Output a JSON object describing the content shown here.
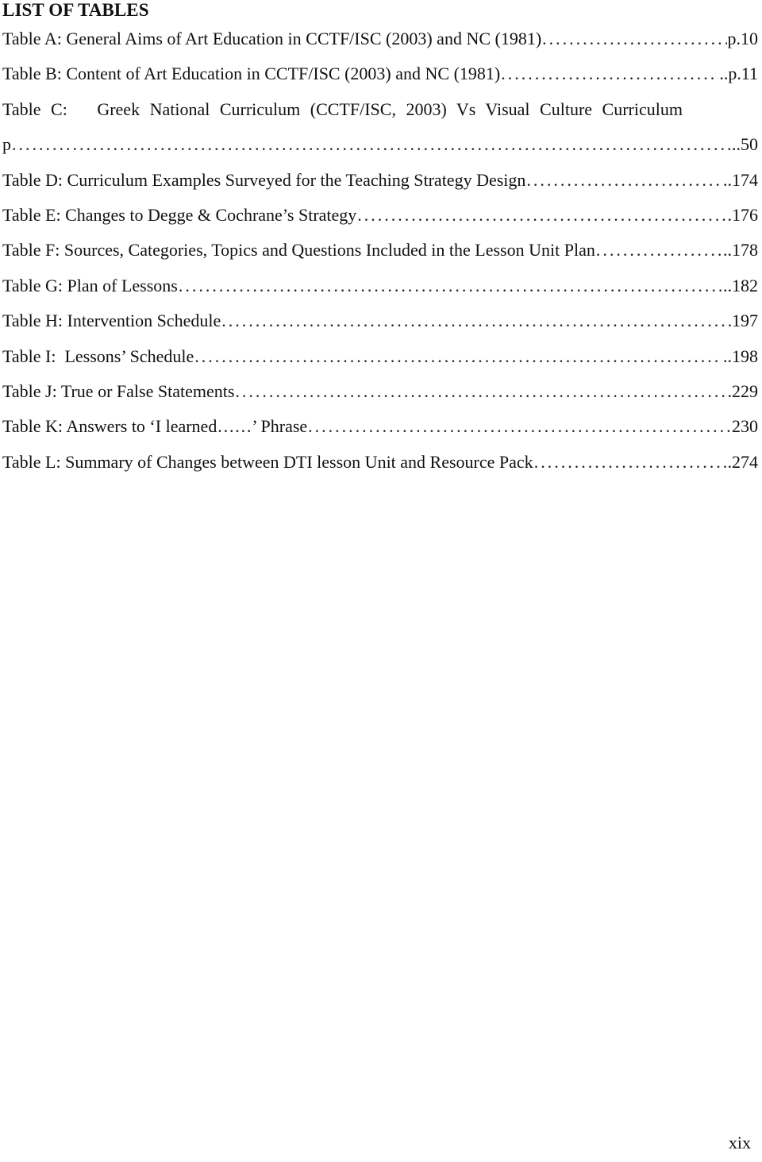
{
  "heading": "LIST OF TABLES",
  "entries": [
    {
      "title": "Table A: General Aims of Art Education in CCTF/ISC (2003) and NC (1981)",
      "page": "p.10"
    },
    {
      "title": "Table B: Content of Art Education in CCTF/ISC (2003) and NC (1981)",
      "page": "..p.11"
    },
    {
      "title_line1": "Table C:   Greek National Curriculum (CCTF/ISC, 2003) Vs Visual Culture Curriculum",
      "title_line2": "p",
      "page": "..50"
    },
    {
      "title": "Table D: Curriculum Examples Surveyed for the Teaching Strategy Design",
      "page": "..174"
    },
    {
      "title": "Table E: Changes to Degge & Cochrane’s Strategy",
      "page": ".176"
    },
    {
      "title": "Table F: Sources, Categories, Topics and Questions Included in the Lesson Unit Plan",
      "page": "..178"
    },
    {
      "title": "Table G: Plan of Lessons",
      "page": "..182"
    },
    {
      "title": "Table H: Intervention Schedule",
      "page": "197"
    },
    {
      "title": "Table I:  Lessons’ Schedule",
      "page": "..198"
    },
    {
      "title": "Table J: True or False Statements",
      "page": ".229"
    },
    {
      "title": "Table K: Answers to ‘I learned……’ Phrase",
      "page": "230"
    },
    {
      "title": "Table L: Summary of Changes between DTI lesson Unit and Resource Pack",
      "page": ".274"
    }
  ],
  "footer": {
    "page_number": "xix"
  }
}
